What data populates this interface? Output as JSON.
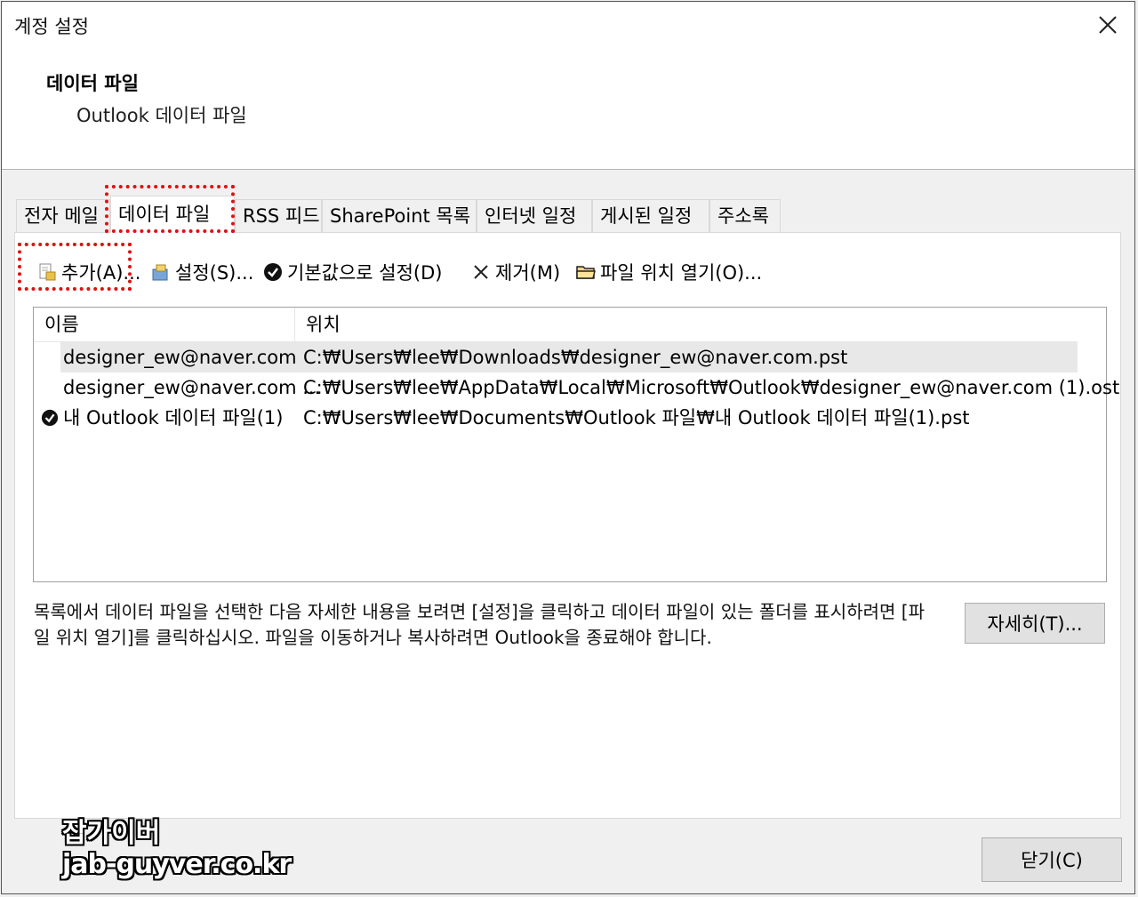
{
  "window": {
    "title": "계정 설정",
    "close_icon": "close-icon",
    "heading": "데이터 파일",
    "subheading": "Outlook 데이터 파일"
  },
  "tabs": [
    {
      "label": "전자 메일",
      "active": false
    },
    {
      "label": "데이터 파일",
      "active": true
    },
    {
      "label": "RSS 피드",
      "active": false
    },
    {
      "label": "SharePoint 목록",
      "active": false
    },
    {
      "label": "인터넷 일정",
      "active": false
    },
    {
      "label": "게시된 일정",
      "active": false
    },
    {
      "label": "주소록",
      "active": false
    }
  ],
  "toolbar": {
    "add": {
      "label": "추가(A)...",
      "icon": "add-file-icon"
    },
    "settings": {
      "label": "설정(S)...",
      "icon": "settings-icon"
    },
    "set_default": {
      "label": "기본값으로 설정(D)",
      "icon": "checkmark-icon"
    },
    "remove": {
      "label": "제거(M)",
      "icon": "remove-x-icon"
    },
    "open_location": {
      "label": "파일 위치 열기(O)...",
      "icon": "folder-icon"
    }
  },
  "list": {
    "columns": {
      "name": "이름",
      "location": "위치"
    },
    "rows": [
      {
        "name": "designer_ew@naver.com",
        "location": "C:₩Users₩lee₩Downloads₩designer_ew@naver.com.pst",
        "selected": true,
        "default": false
      },
      {
        "name": "designer_ew@naver.com ...",
        "location": "C:₩Users₩lee₩AppData₩Local₩Microsoft₩Outlook₩designer_ew@naver.com (1).ost",
        "selected": false,
        "default": false
      },
      {
        "name": "내 Outlook 데이터 파일(1)",
        "location": "C:₩Users₩lee₩Documents₩Outlook 파일₩내 Outlook 데이터 파일(1).pst",
        "selected": false,
        "default": true
      }
    ]
  },
  "description": "목록에서 데이터 파일을 선택한 다음 자세한 내용을 보려면 [설정]을 클릭하고 데이터 파일이 있는 폴더를 표시하려면 [파일 위치 열기]를 클릭하십시오. 파일을 이동하거나 복사하려면 Outlook을 종료해야 합니다.",
  "buttons": {
    "details": "자세히(T)...",
    "close": "닫기(C)"
  },
  "watermark": {
    "line1": "잡가이버",
    "line2": "jab-guyver.co.kr"
  },
  "colors": {
    "highlight": "#e01010",
    "selected_row": "#e8e8e8"
  }
}
